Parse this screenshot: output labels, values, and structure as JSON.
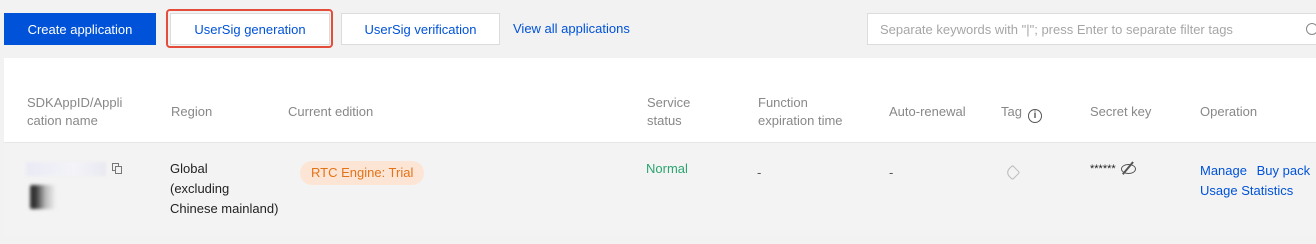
{
  "toolbar": {
    "create_label": "Create application",
    "usersig_generation_label": "UserSig generation",
    "usersig_verification_label": "UserSig verification",
    "view_all_label": "View all applications"
  },
  "search": {
    "placeholder": "Separate keywords with \"|\"; press Enter to separate filter tags"
  },
  "table": {
    "headers": {
      "sdkappid_line1": "SDKAppID/Appli",
      "sdkappid_line2": "cation name",
      "region": "Region",
      "current_edition": "Current edition",
      "service_status_line1": "Service",
      "service_status_line2": "status",
      "function_exp_line1": "Function",
      "function_exp_line2": "expiration time",
      "auto_renewal": "Auto-renewal",
      "tag": "Tag",
      "secret_key": "Secret key",
      "operation": "Operation"
    },
    "rows": [
      {
        "region_line1": "Global",
        "region_line2": "(excluding",
        "region_line3": "Chinese mainland)",
        "edition": "RTC Engine: Trial",
        "service_status": "Normal",
        "function_expiration": "-",
        "auto_renewal": "-",
        "secret_key_masked": "******",
        "op_manage": "Manage",
        "op_buy": "Buy pack",
        "op_usage": "Usage Statistics"
      }
    ]
  },
  "colors": {
    "primary": "#0052d9",
    "highlight_border": "#e34d3a",
    "status_normal": "#2ba471",
    "edition_tag_text": "#e37318",
    "edition_tag_bg": "#fce5d5"
  }
}
